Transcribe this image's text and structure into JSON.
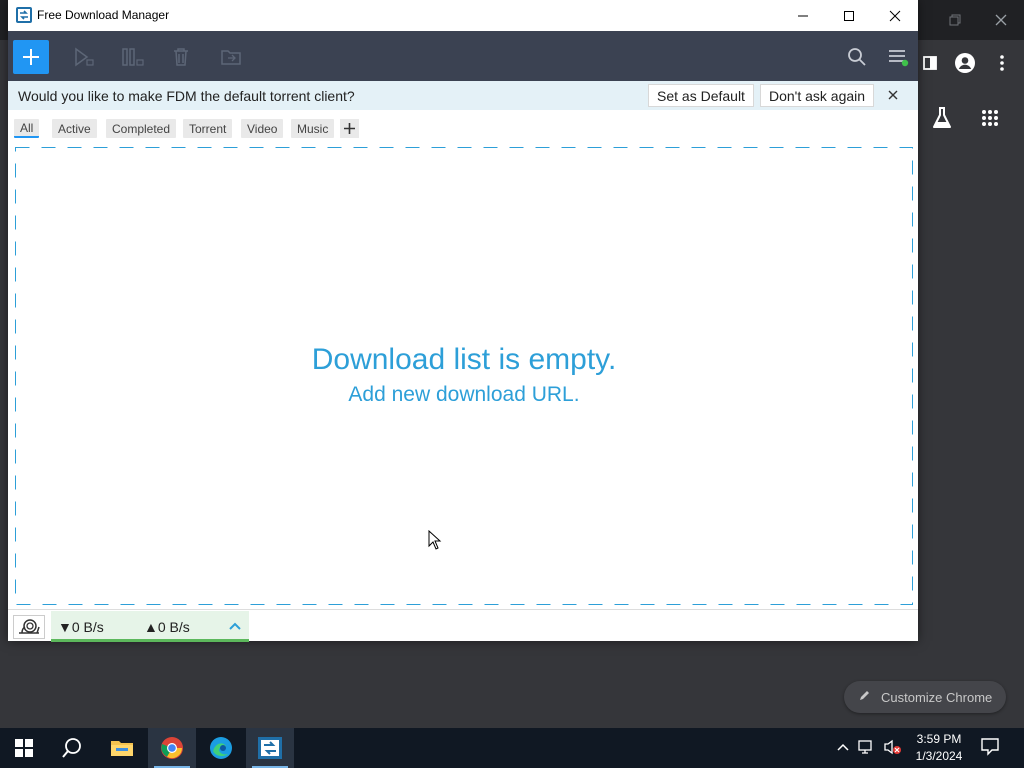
{
  "fdm": {
    "title": "Free Download Manager",
    "notification": {
      "text": "Would you like to make FDM the default torrent client?",
      "set_default_label": "Set as Default",
      "dont_ask_label": "Don't ask again"
    },
    "tabs": [
      {
        "label": "All",
        "active": true
      },
      {
        "label": "Active",
        "active": false
      },
      {
        "label": "Completed",
        "active": false
      },
      {
        "label": "Torrent",
        "active": false
      },
      {
        "label": "Video",
        "active": false
      },
      {
        "label": "Music",
        "active": false
      }
    ],
    "empty_title": "Download list is empty.",
    "empty_subtitle": "Add new download URL.",
    "status": {
      "down_speed": "▼0 B/s",
      "up_speed": "▲0 B/s"
    },
    "accent_color": "#2196f3",
    "toolbar_color": "#3b4252"
  },
  "chrome": {
    "customize_label": "Customize Chrome"
  },
  "taskbar": {
    "time": "3:59 PM",
    "date": "1/3/2024",
    "apps": [
      "start-icon",
      "search-icon",
      "file-explorer-icon",
      "chrome-icon",
      "edge-icon",
      "fdm-icon"
    ]
  }
}
